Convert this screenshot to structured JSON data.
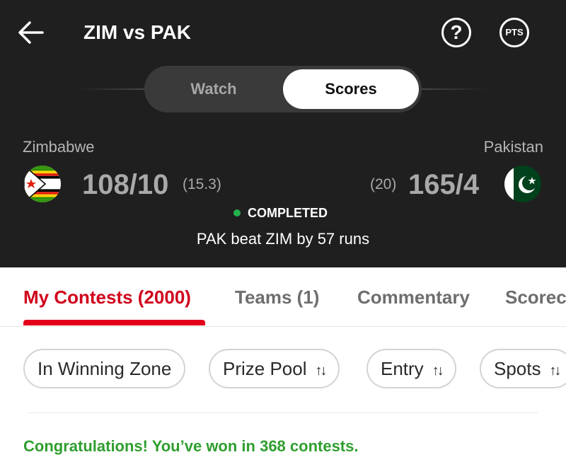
{
  "header": {
    "title": "ZIM vs PAK",
    "help_glyph": "?",
    "points_label": "PTS"
  },
  "toggle": {
    "watch_label": "Watch",
    "scores_label": "Scores",
    "selected": "Scores"
  },
  "match": {
    "team_left": {
      "name": "Zimbabwe",
      "score": "108/10",
      "overs": "(15.3)",
      "flag": "zimbabwe-flag-icon"
    },
    "team_right": {
      "name": "Pakistan",
      "score": "165/4",
      "overs": "(20)",
      "flag": "pakistan-flag-icon"
    },
    "status": "COMPLETED",
    "result": "PAK beat ZIM by 57 runs"
  },
  "tabs": [
    {
      "label": "My Contests (2000)",
      "active": true
    },
    {
      "label": "Teams (1)",
      "active": false
    },
    {
      "label": "Commentary",
      "active": false
    },
    {
      "label": "Scorec",
      "active": false
    }
  ],
  "filters": [
    {
      "label": "In Winning Zone",
      "sortable": false
    },
    {
      "label": "Prize Pool",
      "sortable": true
    },
    {
      "label": "Entry",
      "sortable": true
    },
    {
      "label": "Spots",
      "sortable": true
    }
  ],
  "sort_glyph": "↑↓",
  "congrats_message": "Congratulations! You’ve won in 368 contests.",
  "colors": {
    "header_bg": "#1f1f1f",
    "accent_red": "#d0021b",
    "status_green": "#22b14c",
    "success_text": "#2f9e2f"
  }
}
